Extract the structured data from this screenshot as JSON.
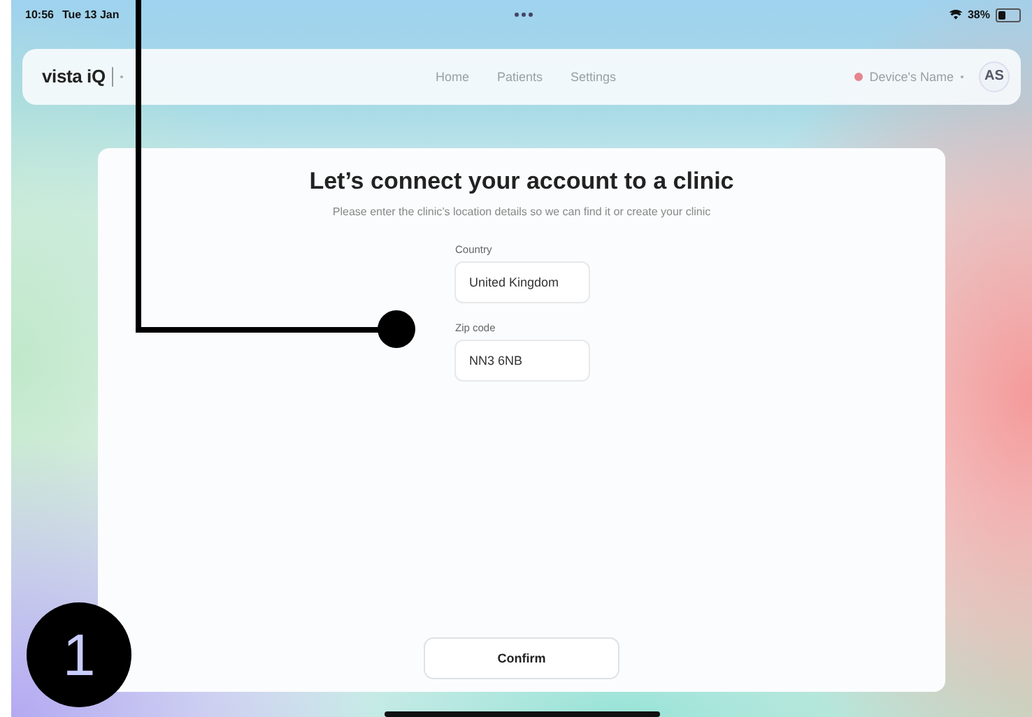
{
  "status_bar": {
    "time": "10:56",
    "date": "Tue 13 Jan",
    "battery": "38%"
  },
  "nav": {
    "logo": "vista iQ",
    "links": [
      {
        "label": "Home"
      },
      {
        "label": "Patients"
      },
      {
        "label": "Settings"
      }
    ],
    "device": {
      "name": "Device's Name",
      "color": "#e8838f"
    },
    "avatar": "AS"
  },
  "card": {
    "title": "Let’s connect your account to a clinic",
    "subtitle": "Please enter the clinic’s location details so we can find it or create your clinic",
    "fields": [
      {
        "label": "Country",
        "value": "United Kingdom"
      },
      {
        "label": "Zip code",
        "value": "NN3 6NB"
      }
    ],
    "button": "Confirm"
  },
  "annotation": {
    "number": "1"
  }
}
